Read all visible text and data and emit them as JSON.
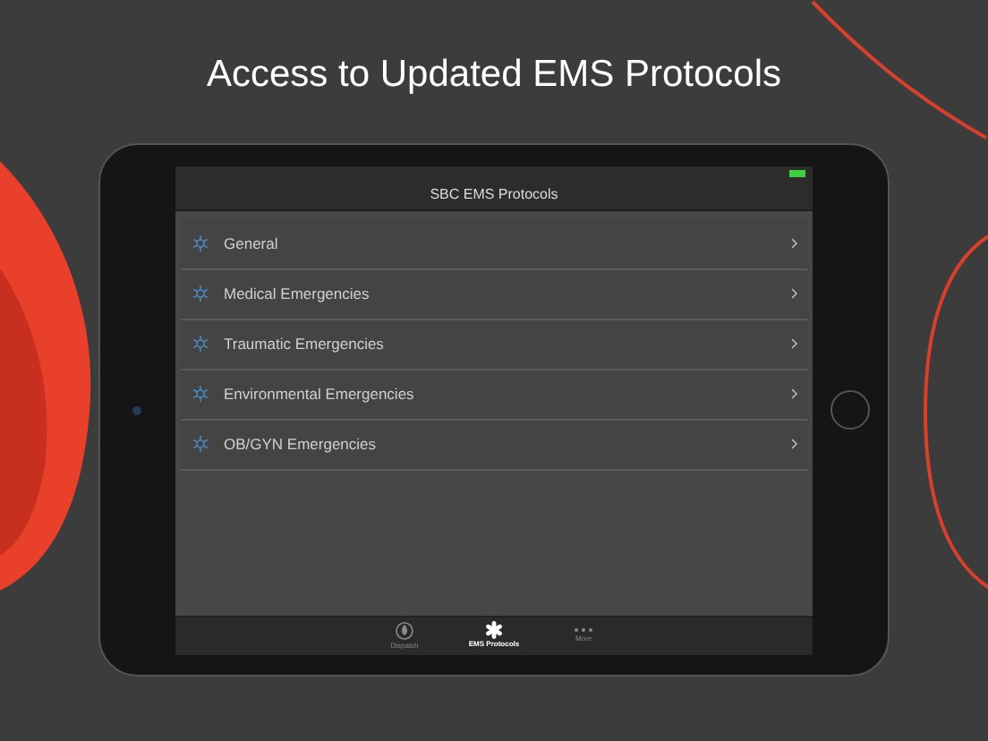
{
  "headline": "Access to Updated EMS Protocols",
  "nav_bar": {
    "title": "SBC EMS Protocols"
  },
  "list": [
    {
      "label": "General"
    },
    {
      "label": "Medical Emergencies"
    },
    {
      "label": "Traumatic Emergencies"
    },
    {
      "label": "Environmental Emergencies"
    },
    {
      "label": "OB/GYN Emergencies"
    }
  ],
  "tab_bar": [
    {
      "label": "Dispatch",
      "kind": "flame",
      "selected": false
    },
    {
      "label": "EMS Protocols",
      "kind": "star",
      "selected": true
    },
    {
      "label": "More",
      "kind": "dots",
      "selected": false
    }
  ]
}
